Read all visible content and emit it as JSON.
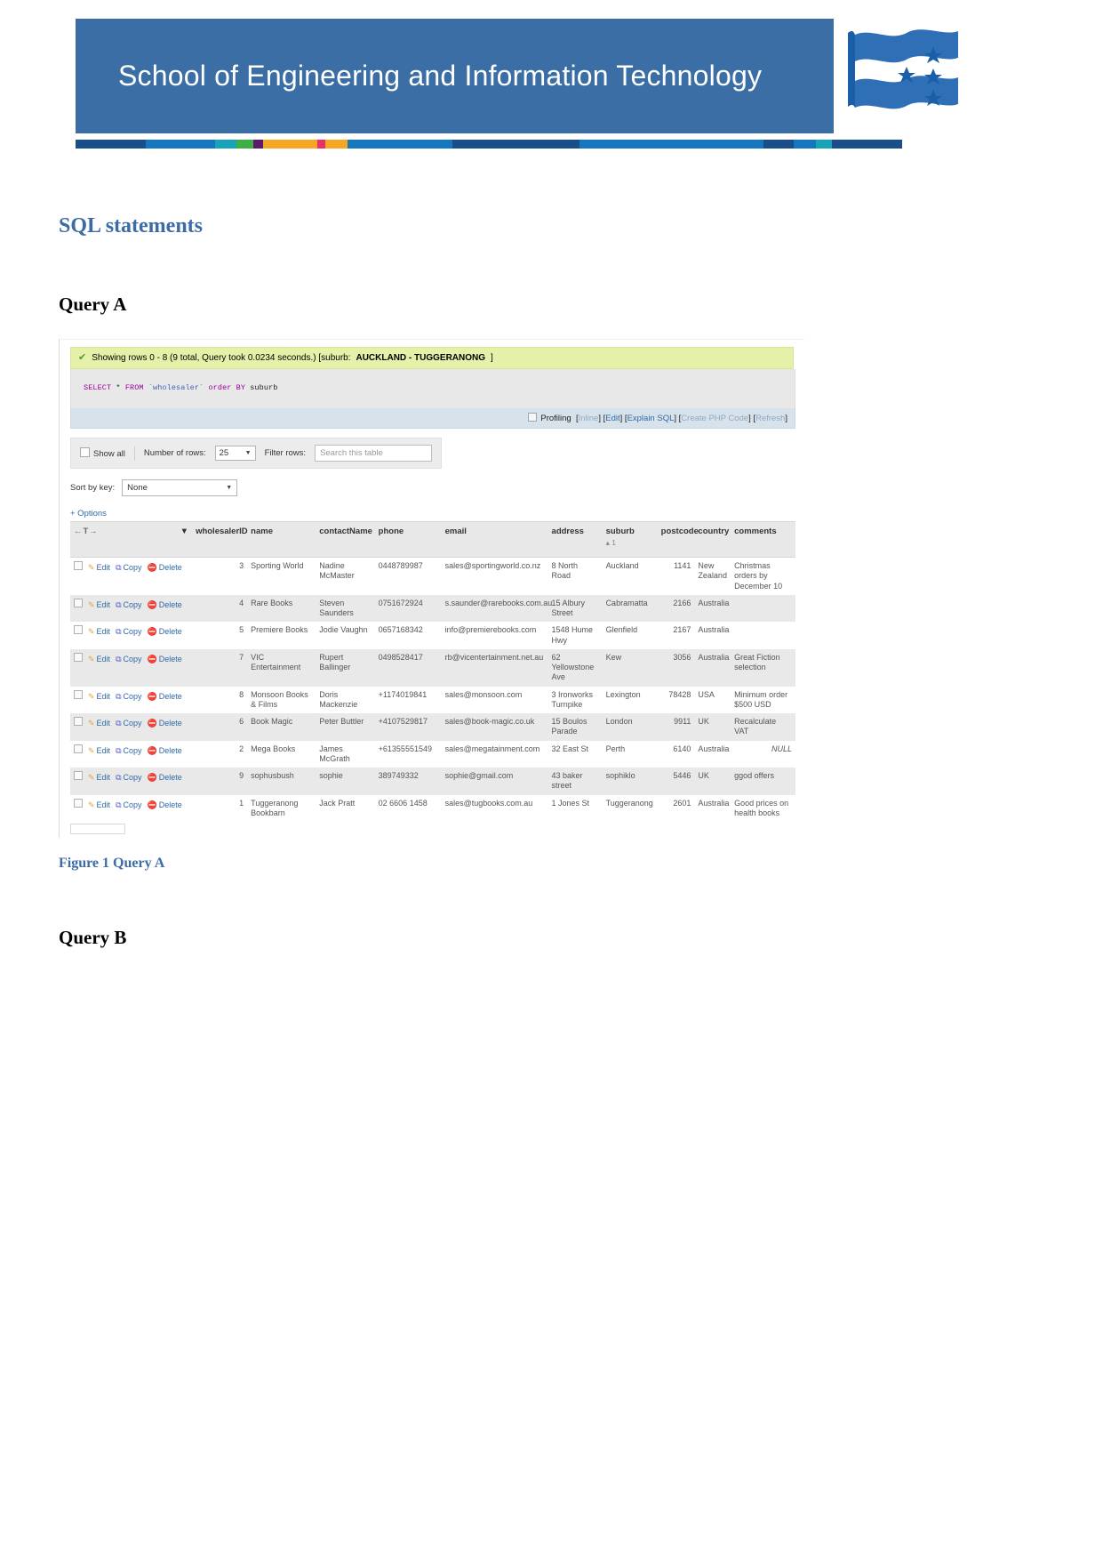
{
  "header": {
    "banner_title": "School of Engineering and Information Technology",
    "banner_color": "#3a6ea5",
    "rule_colors": [
      "#1a4e8a",
      "#1a4e8a",
      "#1577bf",
      "#1577bf",
      "#19a3b8",
      "#3fae45",
      "#5b1a6e",
      "#f5a623",
      "#f5a623",
      "#e8306a",
      "#f5a623",
      "#1577bf",
      "#1577bf",
      "#1a4e8a",
      "#1a4e8a",
      "#1577bf",
      "#1577bf",
      "#1577bf",
      "#1a4e8a",
      "#1577bf",
      "#19a3b8",
      "#1a4e8a",
      "#1a4e8a"
    ]
  },
  "document": {
    "section_title": "SQL statements",
    "query_a_heading": "Query A",
    "query_b_heading": "Query B",
    "figure_caption": "Figure 1 Query A"
  },
  "phpmyadmin": {
    "success_message_prefix": "Showing rows 0 - 8 (9 total, Query took 0.0234 seconds.) [suburb:",
    "success_message_bold": "AUCKLAND - TUGGERANONG",
    "success_message_suffix": "]",
    "check_icon": "check-icon",
    "sql": {
      "kw_select": "SELECT",
      "star": "*",
      "kw_from": "FROM",
      "table": "`wholesaler`",
      "kw_order": "order BY",
      "column": "suburb",
      "full": "SELECT * FROM `wholesaler` order BY suburb"
    },
    "action_bar": {
      "profiling_label": "Profiling",
      "links": [
        "Inline",
        "Edit",
        "Explain SQL",
        "Create PHP Code",
        "Refresh"
      ]
    },
    "toolbar": {
      "show_all_label": "Show all",
      "number_of_rows_label": "Number of rows:",
      "number_of_rows_value": "25",
      "filter_rows_label": "Filter rows:",
      "filter_placeholder": "Search this table"
    },
    "sort_by_key": {
      "label": "Sort by key:",
      "value": "None"
    },
    "options_link": "+ Options",
    "row_actions": {
      "edit": "Edit",
      "copy": "Copy",
      "delete": "Delete"
    },
    "sort_hint": "1",
    "columns": [
      "wholesalerID",
      "name",
      "contactName",
      "phone",
      "email",
      "address",
      "suburb",
      "postcode",
      "country",
      "comments"
    ],
    "rows": [
      {
        "wholesalerID": "3",
        "name": "Sporting World",
        "contactName": "Nadine McMaster",
        "phone": "0448789987",
        "email": "sales@sportingworld.co.nz",
        "address": "8 North Road",
        "suburb": "Auckland",
        "postcode": "1141",
        "country": "New Zealand",
        "comments": "Christmas orders by December 10"
      },
      {
        "wholesalerID": "4",
        "name": "Rare Books",
        "contactName": "Steven Saunders",
        "phone": "0751672924",
        "email": "s.saunder@rarebooks.com.au",
        "address": "15 Albury Street",
        "suburb": "Cabramatta",
        "postcode": "2166",
        "country": "Australia",
        "comments": ""
      },
      {
        "wholesalerID": "5",
        "name": "Premiere Books",
        "contactName": "Jodie Vaughn",
        "phone": "0657168342",
        "email": "info@premierebooks.com",
        "address": "1548 Hume Hwy",
        "suburb": "Glenfield",
        "postcode": "2167",
        "country": "Australia",
        "comments": ""
      },
      {
        "wholesalerID": "7",
        "name": "VIC Entertainment",
        "contactName": "Rupert Ballinger",
        "phone": "0498528417",
        "email": "rb@vicentertainment.net.au",
        "address": "62 Yellowstone Ave",
        "suburb": "Kew",
        "postcode": "3056",
        "country": "Australia",
        "comments": "Great Fiction selection"
      },
      {
        "wholesalerID": "8",
        "name": "Monsoon Books & Films",
        "contactName": "Doris Mackenzie",
        "phone": "+1174019841",
        "email": "sales@monsoon.com",
        "address": "3 Ironworks Turnpike",
        "suburb": "Lexington",
        "postcode": "78428",
        "country": "USA",
        "comments": "Minimum order $500 USD"
      },
      {
        "wholesalerID": "6",
        "name": "Book Magic",
        "contactName": "Peter Buttler",
        "phone": "+4107529817",
        "email": "sales@book-magic.co.uk",
        "address": "15 Boulos Parade",
        "suburb": "London",
        "postcode": "9911",
        "country": "UK",
        "comments": "Recalculate VAT"
      },
      {
        "wholesalerID": "2",
        "name": "Mega Books",
        "contactName": "James McGrath",
        "phone": "+61355551549",
        "email": "sales@megatainment.com",
        "address": "32 East St",
        "suburb": "Perth",
        "postcode": "6140",
        "country": "Australia",
        "comments": "NULL"
      },
      {
        "wholesalerID": "9",
        "name": "sophusbush",
        "contactName": "sophie",
        "phone": "389749332",
        "email": "sophie@gmail.com",
        "address": "43 baker street",
        "suburb": "sophiklo",
        "postcode": "5446",
        "country": "UK",
        "comments": "ggod offers"
      },
      {
        "wholesalerID": "1",
        "name": "Tuggeranong Bookbarn",
        "contactName": "Jack Pratt",
        "phone": "02 6606 1458",
        "email": "sales@tugbooks.com.au",
        "address": "1 Jones St",
        "suburb": "Tuggeranong",
        "postcode": "2601",
        "country": "Australia",
        "comments": "Good prices on health books"
      }
    ]
  }
}
